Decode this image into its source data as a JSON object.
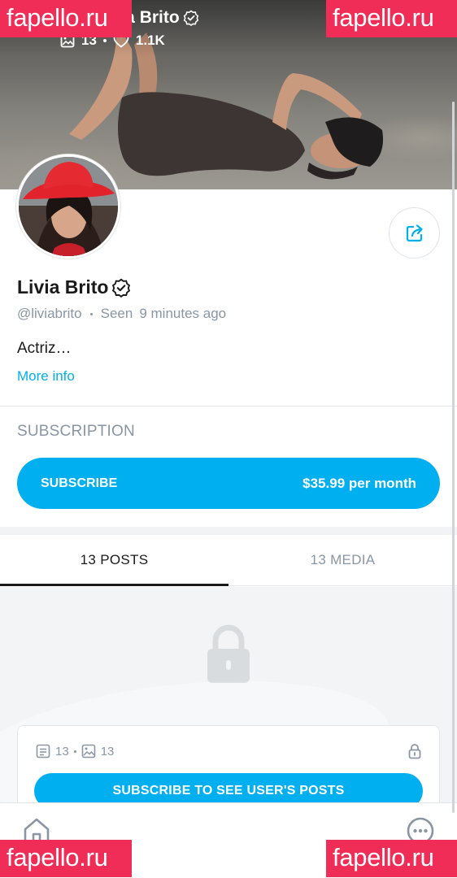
{
  "header": {
    "name": "Livia Brito",
    "posts_count": "13",
    "likes_count": "1.1K"
  },
  "watermark": {
    "text": "fapello.ru",
    "color": "#ef2d56"
  },
  "profile": {
    "name": "Livia Brito",
    "handle": "@liviabrito",
    "seen_label": "Seen",
    "seen_time": "9 minutes ago",
    "bio": "Actriz…",
    "more_info_label": "More info"
  },
  "subscription": {
    "heading": "SUBSCRIPTION",
    "button_label": "SUBSCRIBE",
    "price": "$35.99 per month"
  },
  "tabs": [
    {
      "label": "13 POSTS",
      "active": true
    },
    {
      "label": "13 MEDIA",
      "active": false
    }
  ],
  "locked_card": {
    "posts_count": "13",
    "media_count": "13",
    "button_label": "SUBSCRIBE TO SEE USER'S POSTS"
  },
  "colors": {
    "accent": "#00aff0",
    "muted_text": "#8a96a3",
    "watermark": "#ef2d56"
  },
  "icons": {
    "verified": "verified-badge-icon",
    "image": "image-icon",
    "heart": "heart-icon",
    "share": "share-icon",
    "lock": "lock-icon",
    "post": "post-icon",
    "home": "home-icon",
    "more": "more-icon"
  }
}
